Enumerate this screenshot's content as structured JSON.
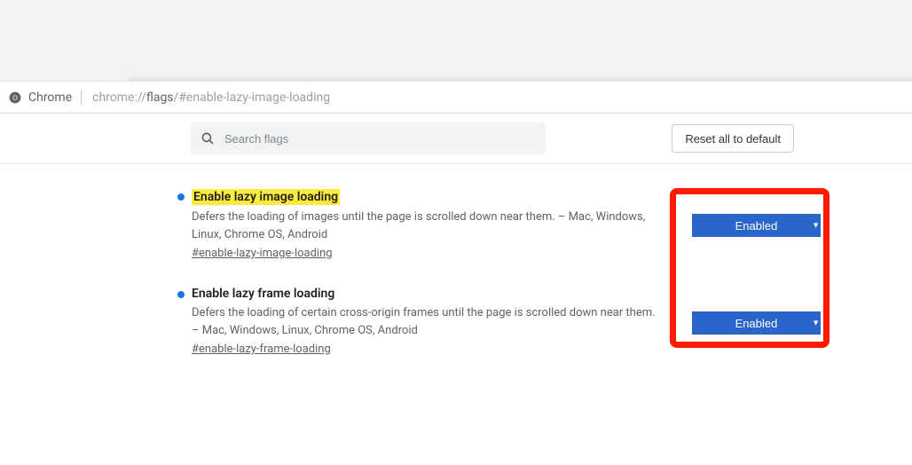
{
  "colors": {
    "accent": "#1a73e8",
    "selectBg": "#2a66c9",
    "highlight": "#ffeb3b",
    "annotation": "#ff1a00"
  },
  "header": {
    "appLabel": "Chrome",
    "urlPrefix": "chrome://",
    "urlBold": "flags",
    "urlSuffix": "/#enable-lazy-image-loading"
  },
  "toolbar": {
    "searchPlaceholder": "Search flags",
    "resetLabel": "Reset all to default"
  },
  "flags": [
    {
      "title": "Enable lazy image loading",
      "highlight": true,
      "desc": "Defers the loading of images until the page is scrolled down near them. – Mac, Windows, Linux, Chrome OS, Android",
      "anchor": "#enable-lazy-image-loading",
      "selected": "Enabled"
    },
    {
      "title": "Enable lazy frame loading",
      "highlight": false,
      "desc": "Defers the loading of certain cross-origin frames until the page is scrolled down near them. – Mac, Windows, Linux, Chrome OS, Android",
      "anchor": "#enable-lazy-frame-loading",
      "selected": "Enabled"
    }
  ]
}
